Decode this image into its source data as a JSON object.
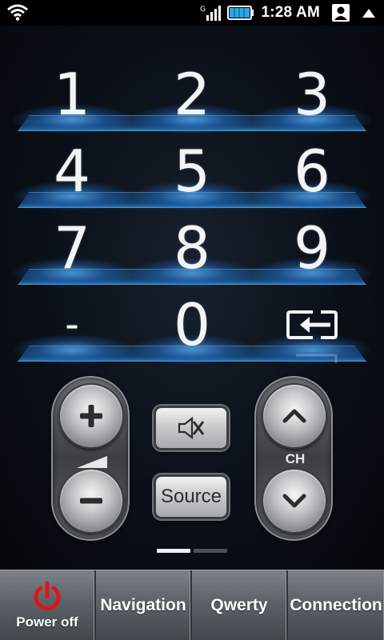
{
  "status_bar": {
    "time": "1:28 AM",
    "icons": [
      "wifi-icon",
      "signal-icon",
      "battery-icon",
      "contact-icon",
      "arrow-up-icon"
    ]
  },
  "keypad": {
    "rows": [
      [
        "1",
        "2",
        "3"
      ],
      [
        "4",
        "5",
        "6"
      ],
      [
        "7",
        "8",
        "9"
      ],
      [
        "-",
        "0",
        "input-source-icon"
      ]
    ]
  },
  "controls": {
    "volume_up_icon": "plus-icon",
    "volume_down_icon": "minus-icon",
    "mute_icon": "mute-icon",
    "source_label": "Source",
    "channel_label": "CH",
    "channel_up_icon": "chevron-up-icon",
    "channel_down_icon": "chevron-down-icon"
  },
  "page_indicator": {
    "pages": 2,
    "active": 1
  },
  "tabs": {
    "power_label": "Power off",
    "navigation_label": "Navigation",
    "qwerty_label": "Qwerty",
    "connection_label": "Connection"
  },
  "colors": {
    "accent_blue": "#2a8fd8",
    "power_red": "#d81818",
    "tabbar": "#5c6268"
  }
}
